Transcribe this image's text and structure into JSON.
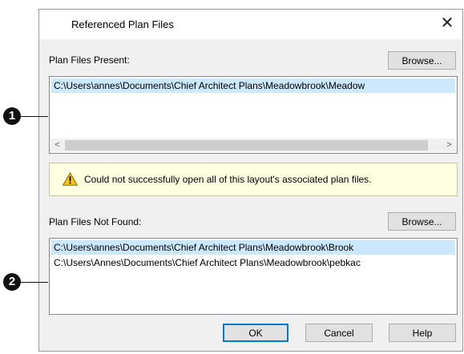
{
  "dialog": {
    "title": "Referenced Plan Files",
    "close_glyph": "✕"
  },
  "present": {
    "label": "Plan Files Present:",
    "browse_label": "Browse...",
    "items": [
      "C:\\Users\\annes\\Documents\\Chief Architect Plans\\Meadowbrook\\Meadow"
    ],
    "scroll_left": "<",
    "scroll_right": ">"
  },
  "warning": {
    "icon": "warning-icon",
    "text": "Could not successfully open all of this layout's associated plan files."
  },
  "not_found": {
    "label": "Plan Files Not Found:",
    "browse_label": "Browse...",
    "items": [
      "C:\\Users\\annes\\Documents\\Chief Architect Plans\\Meadowbrook\\Brook",
      "C:\\Users\\Annes\\Documents\\Chief Architect Plans\\Meadowbrook\\pebkac"
    ]
  },
  "buttons": {
    "ok": "OK",
    "cancel": "Cancel",
    "help": "Help"
  },
  "callouts": [
    "1",
    "2"
  ]
}
